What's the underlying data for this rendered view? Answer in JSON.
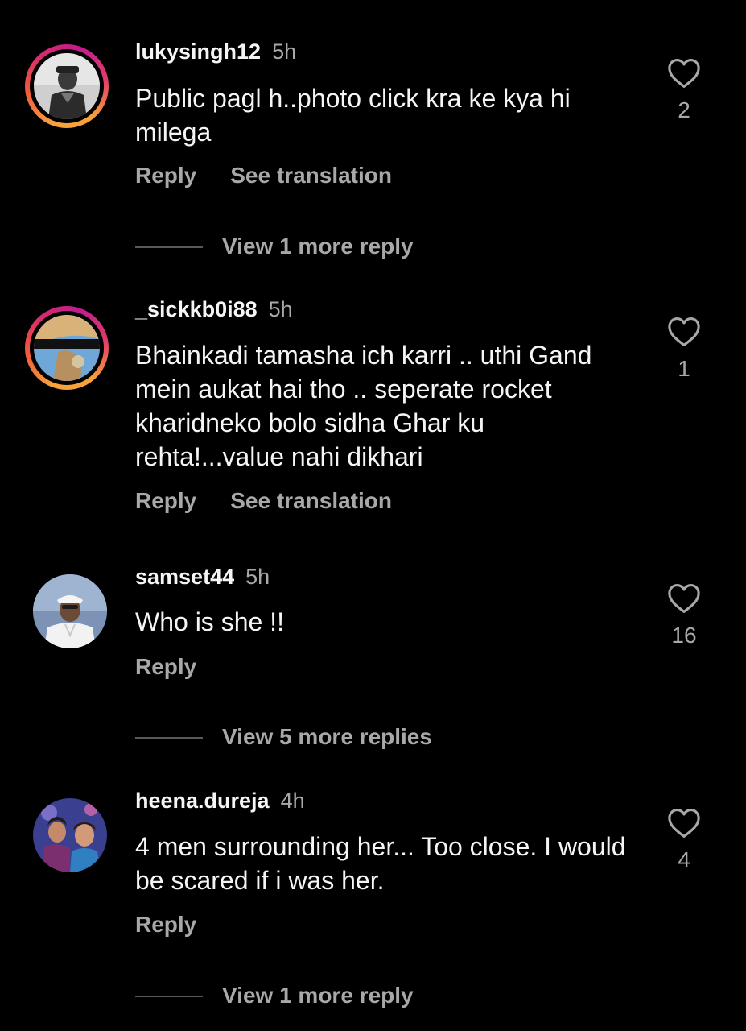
{
  "comments": [
    {
      "username": "lukysingh12",
      "time": "5h",
      "text": "Public pagl h..photo click kra ke kya hi milega",
      "reply": "Reply",
      "see_translation": "See translation",
      "likes": "2",
      "view_replies": "View 1 more reply",
      "avatar_story_ring": true
    },
    {
      "username": "_sickkb0i88",
      "time": "5h",
      "text": "Bhainkadi tamasha ich karri .. uthi Gand mein aukat hai tho .. seperate rocket kharidneko bolo sidha Ghar ku rehta!...value nahi dikhari",
      "reply": "Reply",
      "see_translation": "See translation",
      "likes": "1",
      "avatar_story_ring": true
    },
    {
      "username": "samset44",
      "time": "5h",
      "text": "Who is she !!",
      "reply": "Reply",
      "likes": "16",
      "view_replies": "View 5 more replies",
      "avatar_story_ring": false
    },
    {
      "username": "heena.dureja",
      "time": "4h",
      "text": "4 men surrounding her... Too close. I would be scared if i was her.",
      "reply": "Reply",
      "likes": "4",
      "view_replies": "View 1 more reply",
      "avatar_story_ring": false
    }
  ],
  "icons": {
    "like": "heart-outline-icon"
  },
  "colors": {
    "background": "#000000",
    "primary_text": "#f5f5f5",
    "secondary_text": "#a8a8a8",
    "story_ring": [
      "#f9a23c",
      "#d62b6f",
      "#c21b8e"
    ]
  }
}
